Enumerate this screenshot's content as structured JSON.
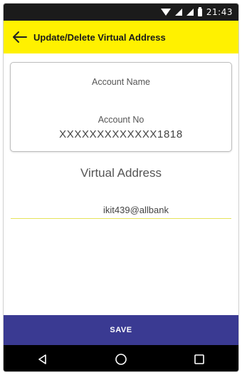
{
  "status_bar": {
    "time": "21:43",
    "icons": [
      "wifi-icon",
      "signal-icon",
      "signal-icon",
      "battery-icon"
    ]
  },
  "app_bar": {
    "title": "Update/Delete Virtual Address",
    "back_icon": "arrow-left-icon",
    "background": "#fff100"
  },
  "account_card": {
    "name_label": "Account Name",
    "number_label": "Account No",
    "number_value": "XXXXXXXXXXXXX1818"
  },
  "virtual_address": {
    "heading": "Virtual Address",
    "input_value": "ikit439@allbank"
  },
  "save_button": {
    "label": "SAVE",
    "color": "#3a3a92"
  },
  "nav_bar": {
    "icons": [
      "back-triangle-icon",
      "home-circle-icon",
      "recents-square-icon"
    ]
  }
}
